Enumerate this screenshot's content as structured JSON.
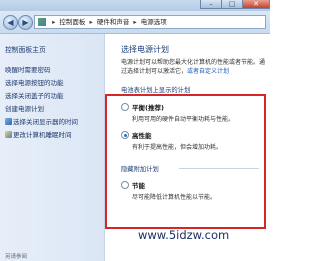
{
  "window": {
    "controls": {
      "minimize": "–",
      "maximize": "□",
      "close": "✕"
    }
  },
  "nav": {
    "back_glyph": "◀",
    "forward_glyph": "▶",
    "breadcrumb": [
      "控制面板",
      "硬件和声音",
      "电源选项"
    ],
    "separator": "▸"
  },
  "sidebar": {
    "title": "控制面板主页",
    "items": [
      {
        "label": "唤醒时需要密码",
        "icon": ""
      },
      {
        "label": "选择电源按钮的功能",
        "icon": ""
      },
      {
        "label": "选择关闭盖子的功能",
        "icon": ""
      },
      {
        "label": "创建电源计划",
        "icon": ""
      },
      {
        "label": "选择关闭显示器的时间",
        "icon": "monitor-icon"
      },
      {
        "label": "更改计算机睡眠时间",
        "icon": "shield-icon"
      }
    ],
    "see_also": "另请参阅"
  },
  "main": {
    "heading": "选择电源计划",
    "description": "电源计划可以帮助您最大化计算机的性能或者节能。通过选择计划可以激活它，或者自定义计划",
    "description_link": "或者自定义计划",
    "plans_label": "电池表计划上显示的计划",
    "plans": [
      {
        "name": "平衡",
        "suffix": "(推荐)",
        "desc": "利用可用的硬件自动平衡功耗与性能。",
        "selected": false
      },
      {
        "name": "高性能",
        "suffix": "",
        "desc": "有利于提高性能，但会增加功耗。",
        "selected": true
      }
    ],
    "hidden_label": "隐藏附加计划",
    "hidden_plans": [
      {
        "name": "节能",
        "suffix": "",
        "desc": "尽可能降低计算机性能以节能。",
        "selected": false
      }
    ]
  },
  "watermark": "www.5idzw.com",
  "colors": {
    "highlight": "#d62727",
    "link": "#1a5fb4",
    "heading": "#1c3d78"
  }
}
